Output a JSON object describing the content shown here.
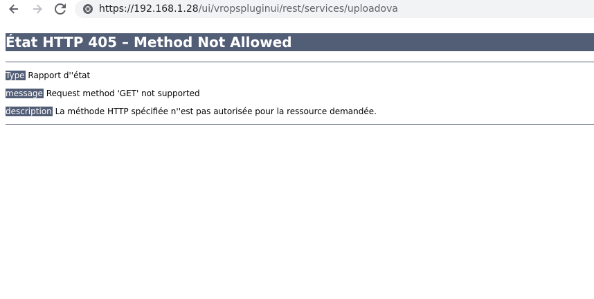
{
  "browser": {
    "url_host": "https://192.168.1.28",
    "url_path": "/ui/vropspluginui/rest/services/uploadova",
    "icons": {
      "back": "arrow-left-icon",
      "forward": "arrow-right-icon",
      "reload": "reload-icon",
      "site_info": "site-info-icon"
    }
  },
  "page": {
    "title": "État HTTP 405 – Method Not Allowed",
    "rows": [
      {
        "label": "Type",
        "value": "Rapport d''état"
      },
      {
        "label": "message",
        "value": "Request method 'GET' not supported"
      },
      {
        "label": "description",
        "value": "La méthode HTTP spécifiée n''est pas autorisée pour la ressource demandée."
      }
    ]
  },
  "colors": {
    "header_band": "#525d76",
    "address_bar": "#f1f3f4"
  }
}
